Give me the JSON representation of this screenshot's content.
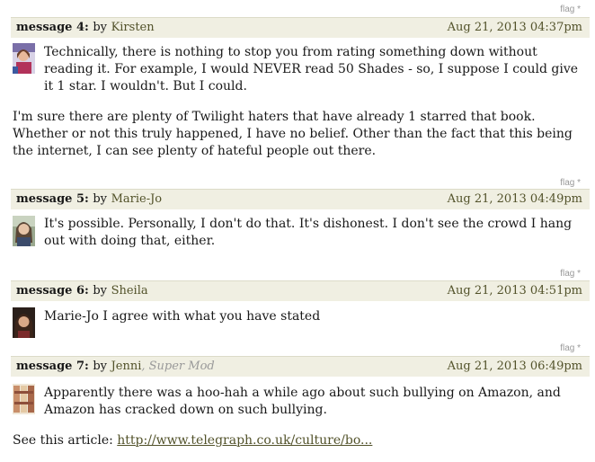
{
  "messages": [
    {
      "flag": "flag *",
      "number_label": "message 4:",
      "by": "by",
      "author": "Kirsten",
      "role": "",
      "date": "Aug 21, 2013 04:37pm",
      "paragraphs": [
        "Technically, there is nothing to stop you from rating something down without reading it. For example, I would NEVER read 50 Shades - so, I suppose I could give it 1 star. I wouldn't. But I could.",
        "I'm sure there are plenty of Twilight haters that have already 1 starred that book. Whether or not this truly happened, I have no belief. Other than the fact that this being the internet, I can see plenty of hateful people out there."
      ]
    },
    {
      "flag": "flag *",
      "number_label": "message 5:",
      "by": "by",
      "author": "Marie-Jo",
      "role": "",
      "date": "Aug 21, 2013 04:49pm",
      "paragraphs": [
        "It's possible. Personally, I don't do that. It's dishonest. I don't see the crowd I hang out with doing that, either."
      ]
    },
    {
      "flag": "flag *",
      "number_label": "message 6:",
      "by": "by",
      "author": "Sheila",
      "role": "",
      "date": "Aug 21, 2013 04:51pm",
      "paragraphs": [
        "Marie-Jo I agree with what you have stated"
      ]
    },
    {
      "flag": "flag *",
      "number_label": "message 7:",
      "by": "by",
      "author": "Jenni",
      "role": ", Super Mod",
      "date": "Aug 21, 2013 06:49pm",
      "paragraphs": [
        "Apparently there was a hoo-hah a while ago about such bullying on Amazon, and Amazon has cracked down on such bullying."
      ],
      "see_article_prefix": "See this article: ",
      "see_article_link": "http://www.telegraph.co.uk/culture/bo..."
    }
  ],
  "colors": {
    "header_bg": "#f0efe2",
    "link": "#52522a",
    "muted": "#999999"
  }
}
